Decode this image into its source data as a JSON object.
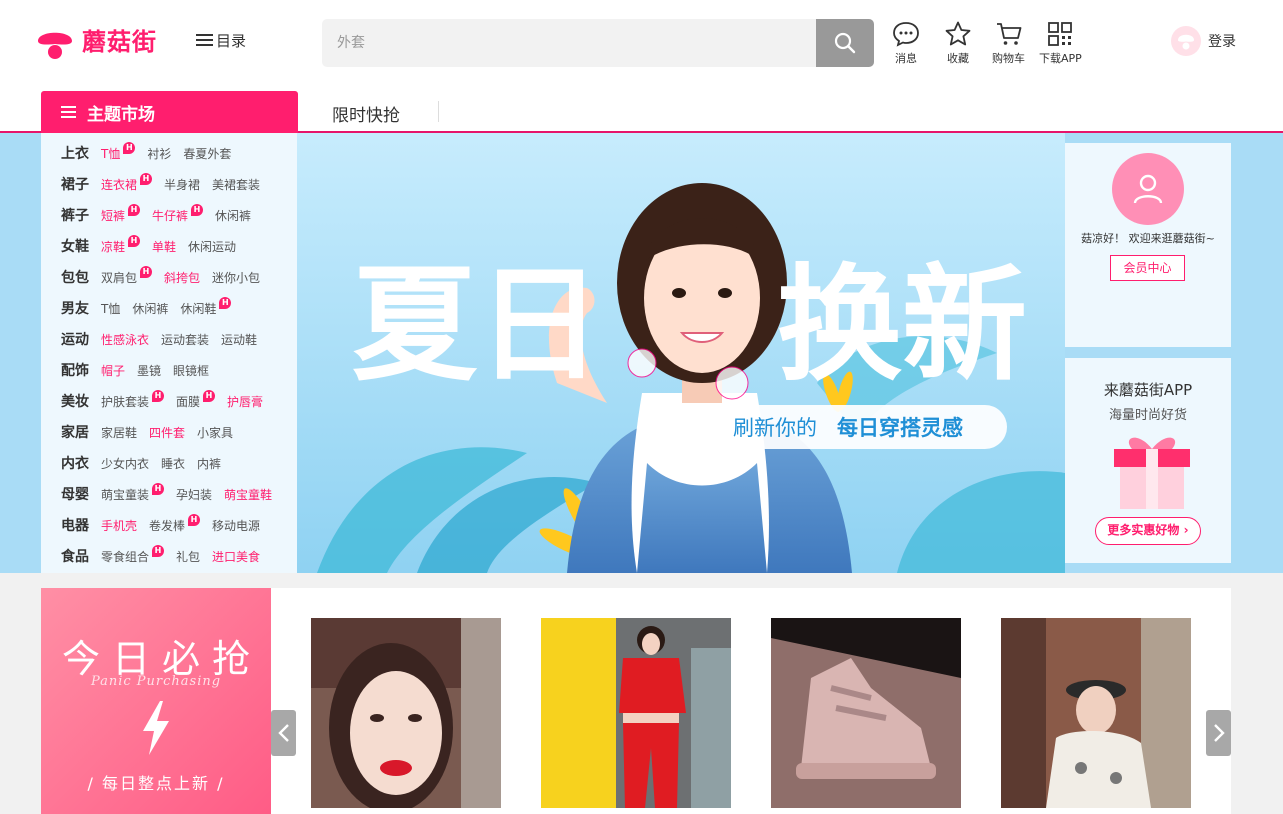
{
  "brand": {
    "name": "蘑菇街",
    "color": "#ff1e6e"
  },
  "header": {
    "catalog_label": "目录",
    "search": {
      "placeholder": "外套",
      "button_icon": "search-icon"
    },
    "nav": [
      {
        "label": "消息",
        "icon": "message-icon"
      },
      {
        "label": "收藏",
        "icon": "star-icon"
      },
      {
        "label": "购物车",
        "icon": "cart-icon"
      },
      {
        "label": "下载APP",
        "icon": "qrcode-icon"
      }
    ],
    "login_label": "登录"
  },
  "tabs": {
    "main": "主题市场",
    "flash": "限时快抢"
  },
  "categories": [
    {
      "name": "上衣",
      "items": [
        {
          "t": "T恤",
          "hl": true,
          "hot": true
        },
        {
          "t": "衬衫"
        },
        {
          "t": "春夏外套"
        }
      ]
    },
    {
      "name": "裙子",
      "items": [
        {
          "t": "连衣裙",
          "hl": true,
          "hot": true
        },
        {
          "t": "半身裙"
        },
        {
          "t": "美裙套装"
        }
      ]
    },
    {
      "name": "裤子",
      "items": [
        {
          "t": "短裤",
          "hl": true,
          "hot": true
        },
        {
          "t": "牛仔裤",
          "hl": true,
          "hot": true
        },
        {
          "t": "休闲裤"
        }
      ]
    },
    {
      "name": "女鞋",
      "items": [
        {
          "t": "凉鞋",
          "hl": true,
          "hot": true
        },
        {
          "t": "单鞋",
          "hl": true
        },
        {
          "t": "休闲运动"
        }
      ]
    },
    {
      "name": "包包",
      "items": [
        {
          "t": "双肩包",
          "hot": true
        },
        {
          "t": "斜挎包",
          "hl": true
        },
        {
          "t": "迷你小包"
        }
      ]
    },
    {
      "name": "男友",
      "items": [
        {
          "t": "T恤"
        },
        {
          "t": "休闲裤"
        },
        {
          "t": "休闲鞋",
          "hot": true
        }
      ]
    },
    {
      "name": "运动",
      "items": [
        {
          "t": "性感泳衣",
          "hl": true
        },
        {
          "t": "运动套装"
        },
        {
          "t": "运动鞋"
        }
      ]
    },
    {
      "name": "配饰",
      "items": [
        {
          "t": "帽子",
          "hl": true
        },
        {
          "t": "墨镜"
        },
        {
          "t": "眼镜框"
        }
      ]
    },
    {
      "name": "美妆",
      "items": [
        {
          "t": "护肤套装",
          "hot": true
        },
        {
          "t": "面膜",
          "hot": true
        },
        {
          "t": "护唇膏",
          "hl": true
        }
      ]
    },
    {
      "name": "家居",
      "items": [
        {
          "t": "家居鞋"
        },
        {
          "t": "四件套",
          "hl": true
        },
        {
          "t": "小家具"
        }
      ]
    },
    {
      "name": "内衣",
      "items": [
        {
          "t": "少女内衣"
        },
        {
          "t": "睡衣"
        },
        {
          "t": "内裤"
        }
      ]
    },
    {
      "name": "母婴",
      "items": [
        {
          "t": "萌宝童装",
          "hot": true
        },
        {
          "t": "孕妇装"
        },
        {
          "t": "萌宝童鞋",
          "hl": true
        }
      ]
    },
    {
      "name": "电器",
      "items": [
        {
          "t": "手机壳",
          "hl": true
        },
        {
          "t": "卷发棒",
          "hot": true
        },
        {
          "t": "移动电源"
        }
      ]
    },
    {
      "name": "食品",
      "items": [
        {
          "t": "零食组合",
          "hot": true
        },
        {
          "t": "礼包"
        },
        {
          "t": "进口美食",
          "hl": true
        }
      ]
    }
  ],
  "banner": {
    "title_left": "夏日",
    "title_right": "换新",
    "tag_plain": "刷新你的",
    "tag_bold": "每日穿搭灵感"
  },
  "user_panel": {
    "greeting": "菇凉好！ 欢迎来逛蘑菇街~",
    "member_button": "会员中心"
  },
  "app_panel": {
    "title": "来蘑菇街APP",
    "subtitle": "海量时尚好货",
    "button": "更多实惠好物"
  },
  "flash_sale": {
    "title": "今日必抢",
    "subtitle_en": "Panic Purchasing",
    "tagline": "/ 每日整点上新 /"
  },
  "products": [
    {
      "alt": "lipstick-portrait"
    },
    {
      "alt": "red-outfit"
    },
    {
      "alt": "pink-sneakers"
    },
    {
      "alt": "beret-sweater"
    }
  ]
}
